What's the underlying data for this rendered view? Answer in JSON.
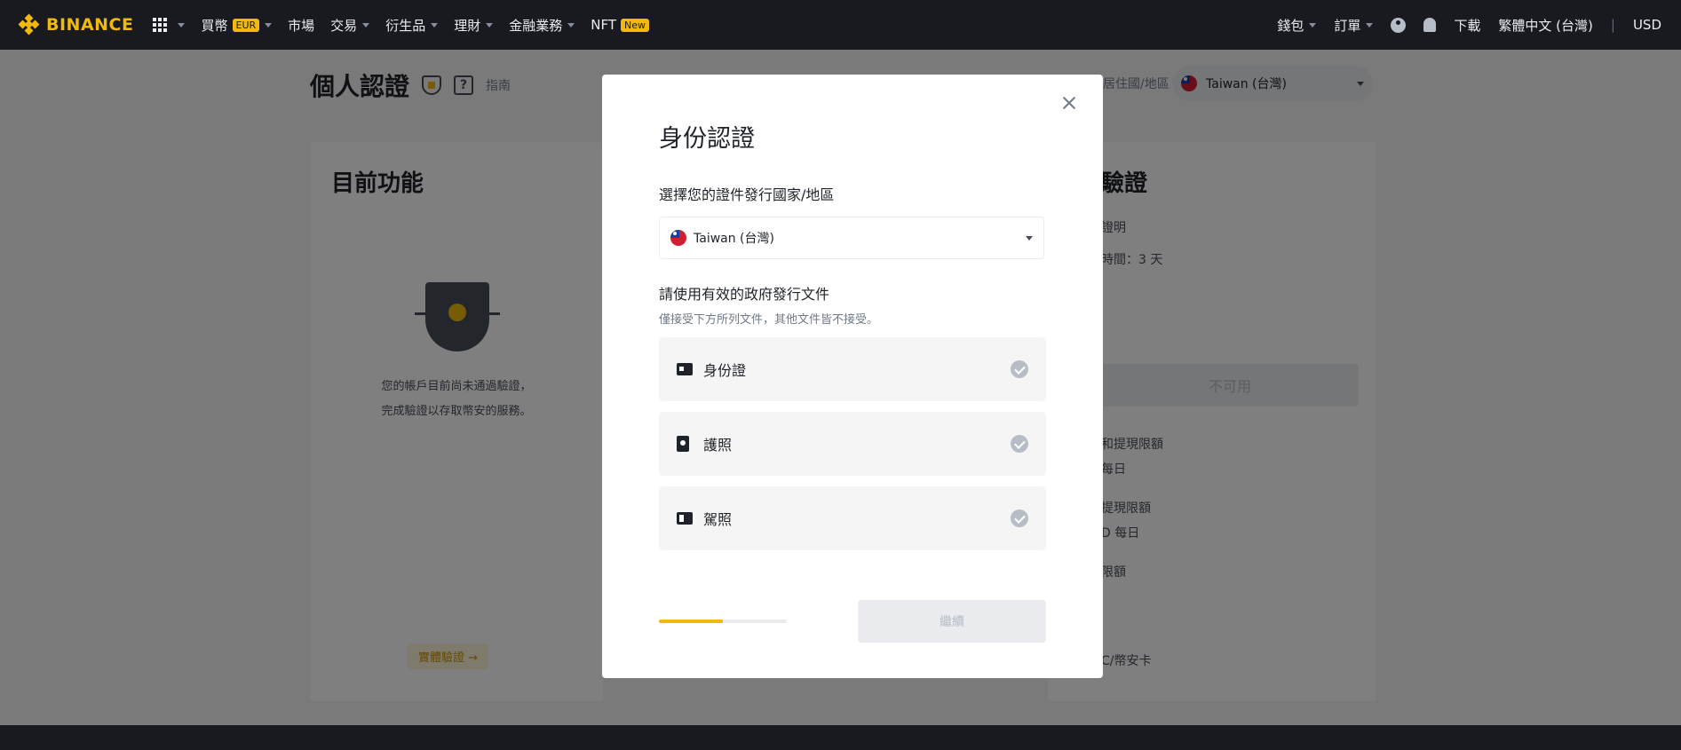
{
  "nav": {
    "brand": "BINANCE",
    "buy_crypto": "買幣",
    "buy_crypto_badge": "EUR",
    "markets": "市場",
    "trade": "交易",
    "derivatives": "衍生品",
    "earn": "理財",
    "finance": "金融業務",
    "nft": "NFT",
    "nft_badge": "New",
    "wallet": "錢包",
    "orders": "訂單",
    "download": "下載",
    "language": "繁體中文 (台灣)",
    "currency": "USD"
  },
  "page": {
    "title": "個人認證",
    "guide": "指南",
    "residence_label": "居住國/地區",
    "residence_value": "Taiwan (台灣)",
    "left_card": {
      "title": "目前功能",
      "message_line1": "您的帳戶目前尚未通過驗證，",
      "message_line2": "完成驗證以存取幣安的服務。",
      "physical_link": "實體驗證 →"
    },
    "right_card": {
      "title": "驗證",
      "line1": "證明",
      "line2": "時間：3 天",
      "unavailable_button": "不可用",
      "line3": "和提現限額",
      "line4": "每日",
      "line5": "提現限額",
      "line6": "D 每日",
      "line7": "限額",
      "line8": "C/幣安卡"
    }
  },
  "modal": {
    "title": "身份認證",
    "country_label": "選擇您的證件發行國家/地區",
    "country_value": "Taiwan (台灣)",
    "documents_label": "請使用有效的政府發行文件",
    "documents_note": "僅接受下方所列文件，其他文件皆不接受。",
    "documents": [
      {
        "label": "身份證",
        "icon": "id-card-icon"
      },
      {
        "label": "護照",
        "icon": "passport-icon"
      },
      {
        "label": "駕照",
        "icon": "driver-license-icon"
      }
    ],
    "progress_fraction": 0.5,
    "continue_label": "繼續"
  },
  "colors": {
    "brand_yellow": "#f0b90b",
    "nav_bg": "#181a20",
    "disabled_gray": "#eaecef"
  }
}
